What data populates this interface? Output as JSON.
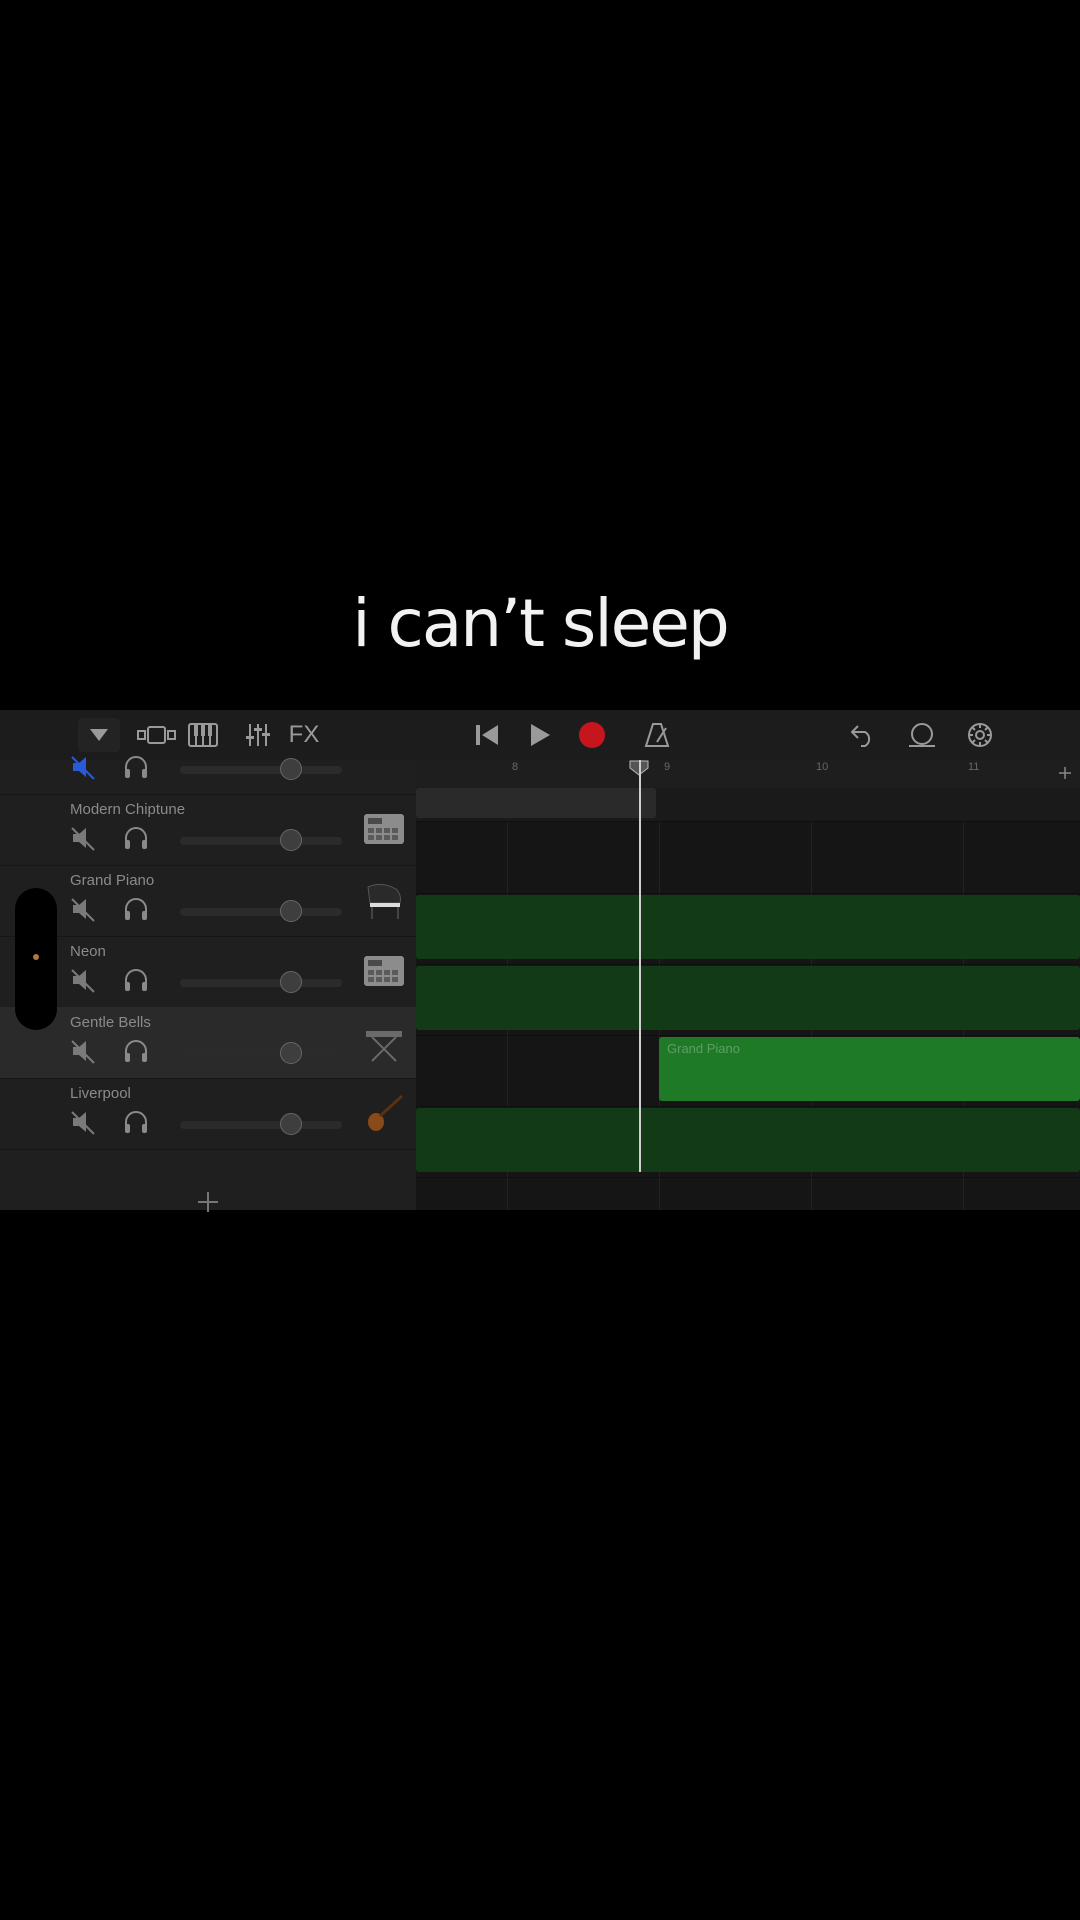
{
  "caption": "i can’t sleep",
  "toolbar": {
    "fx_label": "FX"
  },
  "ruler": {
    "bars": [
      "8",
      "9",
      "10",
      "11"
    ]
  },
  "tracks": [
    {
      "name": "",
      "muted": true,
      "volume": 0.7,
      "instrument": "drum-machine"
    },
    {
      "name": "Modern Chiptune",
      "muted": true,
      "volume": 0.7,
      "instrument": "drum-machine"
    },
    {
      "name": "Grand Piano",
      "muted": true,
      "volume": 0.7,
      "instrument": "grand-piano"
    },
    {
      "name": "Neon",
      "muted": true,
      "volume": 0.7,
      "instrument": "drum-machine"
    },
    {
      "name": "Gentle Bells",
      "muted": true,
      "volume": 0.7,
      "instrument": "keyboard-stand",
      "selected": true
    },
    {
      "name": "Liverpool",
      "muted": true,
      "volume": 0.7,
      "instrument": "violin"
    }
  ],
  "regions": {
    "gentle_bells_label": "Grand Piano"
  },
  "colors": {
    "record": "#c4161c",
    "region_dark": "#123a17",
    "region_bright": "#1f7a28",
    "mute_active": "#2a5bd6"
  }
}
